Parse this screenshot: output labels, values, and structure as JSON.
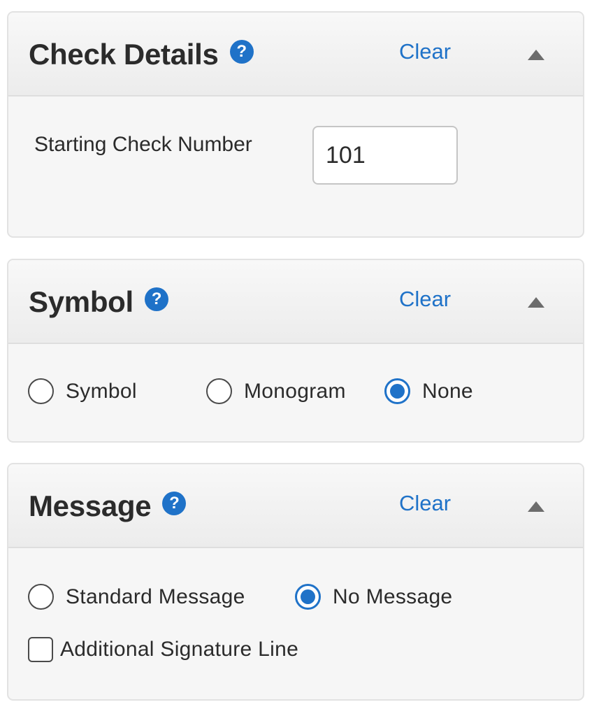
{
  "check_details": {
    "title": "Check Details",
    "help_glyph": "?",
    "clear_label": "Clear",
    "starting_check_number_label": "Starting Check Number",
    "starting_check_number_value": "101",
    "expanded": true
  },
  "symbol": {
    "title": "Symbol",
    "help_glyph": "?",
    "clear_label": "Clear",
    "expanded": true,
    "options": [
      {
        "label": "Symbol",
        "checked": false
      },
      {
        "label": "Monogram",
        "checked": false
      },
      {
        "label": "None",
        "checked": true
      }
    ]
  },
  "message": {
    "title": "Message",
    "help_glyph": "?",
    "clear_label": "Clear",
    "expanded": true,
    "options": [
      {
        "label": "Standard Message",
        "checked": false
      },
      {
        "label": "No Message",
        "checked": true
      }
    ],
    "additional_signature_line_label": "Additional Signature Line",
    "additional_signature_line_checked": false
  },
  "colors": {
    "accent": "#1f72c8",
    "panel_background": "#f6f6f6",
    "header_background": "#ececec",
    "text": "#2b2b2b"
  },
  "icons": [
    "help-icon",
    "collapse-arrow-icon"
  ]
}
